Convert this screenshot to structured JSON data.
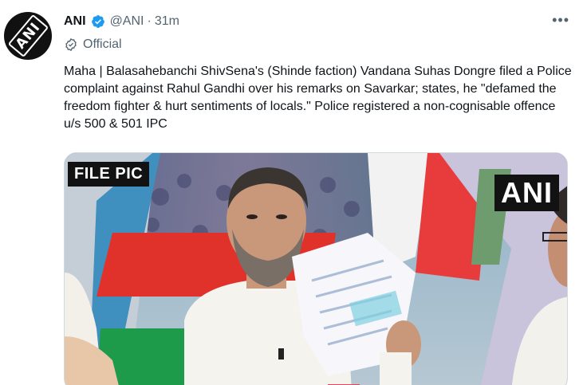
{
  "tweet": {
    "display_name": "ANI",
    "verified_icon": "verified-badge-icon",
    "handle": "@ANI",
    "separator": "·",
    "time": "31m",
    "more_label": "•••",
    "official_label": "Official",
    "official_icon": "official-badge-icon",
    "avatar_logo": "ANI",
    "text": "Maha | Balasahebanchi ShivSena's (Shinde faction) Vandana Suhas Dongre filed a Police complaint against Rahul Gandhi over his remarks on Savarkar; states, he \"defamed the freedom fighter & hurt sentiments of locals.\" Police registered a non-cognisable offence u/s 500 & 501 IPC",
    "media": {
      "overlay_left": "FILE PIC",
      "overlay_right": "ANI"
    }
  },
  "colors": {
    "accent_blue": "#1d9bf0",
    "secondary_text": "#536471",
    "primary_text": "#0f1419"
  }
}
